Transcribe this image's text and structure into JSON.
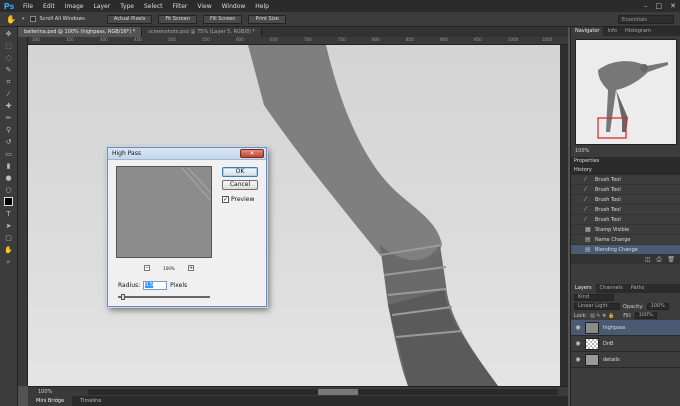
{
  "app": {
    "logo": "Ps"
  },
  "menu": [
    "File",
    "Edit",
    "Image",
    "Layer",
    "Type",
    "Select",
    "Filter",
    "View",
    "Window",
    "Help"
  ],
  "options": {
    "scroll_all": "Scroll All Windows",
    "buttons": [
      "Actual Pixels",
      "Fit Screen",
      "Fill Screen",
      "Print Size"
    ],
    "workspace": "Essentials"
  },
  "tabs": [
    {
      "label": "ballerina.psd @ 100% (highpass, RGB/16*) *"
    },
    {
      "label": "screenshots.psd @ 75% (Layer 5, RGB/8) *"
    }
  ],
  "ruler": [
    "300",
    "350",
    "400",
    "450",
    "500",
    "550",
    "600",
    "650",
    "700",
    "750",
    "800",
    "850",
    "900",
    "950",
    "1000",
    "1050"
  ],
  "status": {
    "zoom": "100%"
  },
  "bottom_tabs": [
    "Mini Bridge",
    "Timeline"
  ],
  "navigator": {
    "tabs": [
      "Navigator",
      "Info",
      "Histogram"
    ],
    "zoom": "100%"
  },
  "properties": "Properties",
  "history": {
    "title": "History",
    "items": [
      {
        "label": "Brush Tool",
        "icon": "brush"
      },
      {
        "label": "Brush Tool",
        "icon": "brush"
      },
      {
        "label": "Brush Tool",
        "icon": "brush"
      },
      {
        "label": "Brush Tool",
        "icon": "brush"
      },
      {
        "label": "Brush Tool",
        "icon": "brush"
      },
      {
        "label": "Stamp Visible",
        "icon": "stamp"
      },
      {
        "label": "Name Change",
        "icon": "doc"
      },
      {
        "label": "Blending Change",
        "icon": "doc"
      }
    ]
  },
  "layers": {
    "tabs": [
      "Layers",
      "Channels",
      "Paths"
    ],
    "kind": "Kind",
    "blend": "Linear Light",
    "opacity_label": "Opacity:",
    "opacity": "100%",
    "lock_label": "Lock:",
    "fill_label": "Fill:",
    "fill": "100%",
    "items": [
      {
        "name": "highpass"
      },
      {
        "name": "DnB"
      },
      {
        "name": "details"
      }
    ]
  },
  "dialog": {
    "title": "High Pass",
    "ok": "OK",
    "cancel": "Cancel",
    "preview": "Preview",
    "zoom": "100%",
    "radius_label": "Radius:",
    "radius": "0.5",
    "unit": "Pixels"
  }
}
